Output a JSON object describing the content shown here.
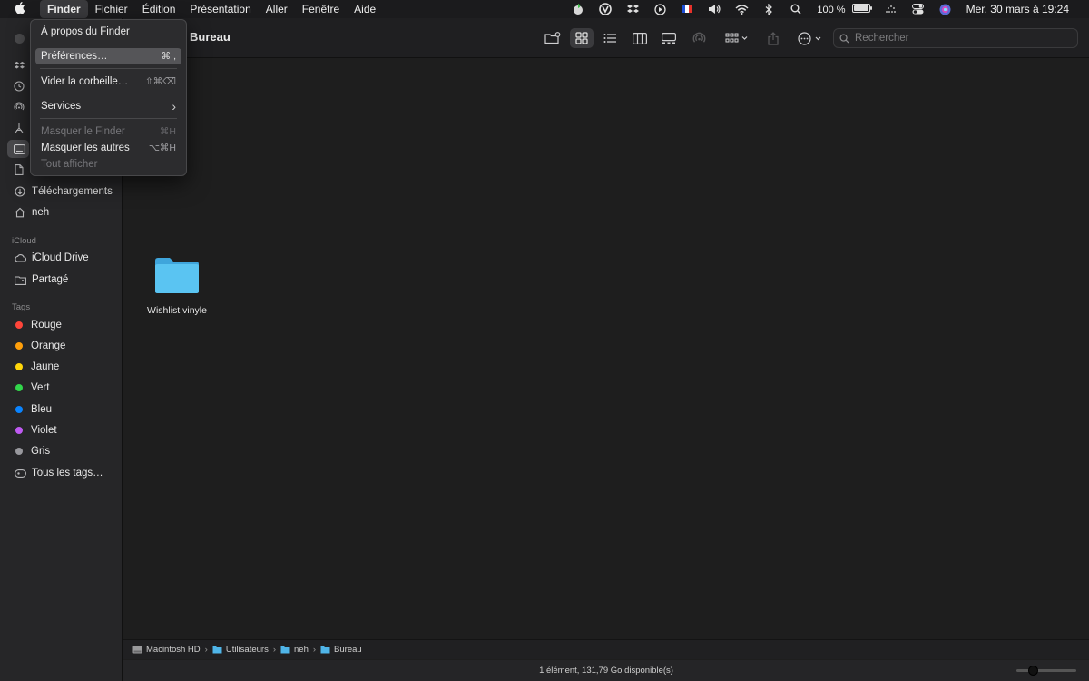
{
  "menubar": {
    "apple": "",
    "items": [
      {
        "label": "Finder",
        "active": true
      },
      {
        "label": "Fichier"
      },
      {
        "label": "Édition"
      },
      {
        "label": "Présentation"
      },
      {
        "label": "Aller"
      },
      {
        "label": "Fenêtre"
      },
      {
        "label": "Aide"
      }
    ],
    "battery": "100 %",
    "datetime": "Mer. 30 mars à  19:24"
  },
  "dropdown": {
    "about": "À propos du Finder",
    "preferences": "Préférences…",
    "preferences_shortcut": "⌘ ,",
    "empty_trash": "Vider la corbeille…",
    "empty_trash_shortcut": "⇧⌘⌫",
    "services": "Services",
    "services_arrow": "›",
    "hide_finder": "Masquer le Finder",
    "hide_finder_shortcut": "⌘H",
    "hide_others": "Masquer les autres",
    "hide_others_shortcut": "⌥⌘H",
    "show_all": "Tout afficher"
  },
  "sidebar": {
    "downloads": "Téléchargements",
    "home": "neh",
    "icloud_section": "iCloud",
    "icloud_drive": "iCloud Drive",
    "shared": "Partagé",
    "tags_section": "Tags",
    "tags": [
      {
        "label": "Rouge",
        "color": "#ff453a"
      },
      {
        "label": "Orange",
        "color": "#ff9f0a"
      },
      {
        "label": "Jaune",
        "color": "#ffd60a"
      },
      {
        "label": "Vert",
        "color": "#32d74b"
      },
      {
        "label": "Bleu",
        "color": "#0a84ff"
      },
      {
        "label": "Violet",
        "color": "#bf5af2"
      },
      {
        "label": "Gris",
        "color": "#98989d"
      }
    ],
    "all_tags": "Tous les tags…"
  },
  "toolbar": {
    "title": "Bureau",
    "search_placeholder": "Rechercher"
  },
  "content": {
    "items": [
      {
        "label": "Wishlist vinyle",
        "icon": "folder-icon",
        "color": "#5ac8fa"
      }
    ]
  },
  "pathbar": {
    "crumbs": [
      "Macintosh HD",
      "Utilisateurs",
      "neh",
      "Bureau"
    ],
    "separator": "›"
  },
  "status": {
    "text": "1 élément, 131,79 Go disponible(s)"
  }
}
